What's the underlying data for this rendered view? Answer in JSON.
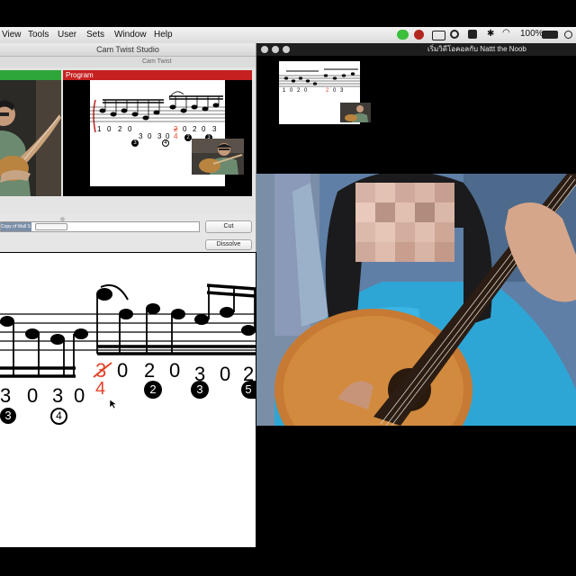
{
  "menubar": {
    "items": [
      "View",
      "Tools",
      "User",
      "Sets",
      "Window",
      "Help"
    ],
    "battery": "100%"
  },
  "cam_window": {
    "title": "Cam Twist Studio",
    "subtitle": "Cam Twist",
    "program_label": "Program",
    "source_field": "Copy of Wall S",
    "cut_button": "Cut",
    "dissolve_button": "Dissolve"
  },
  "video_window": {
    "title": "เริ่มวิดีโอคอลกับ Nattt the Noob"
  },
  "sheet_large": {
    "numbers": [
      "3",
      "0",
      "3",
      "0",
      "3",
      "0",
      "2",
      "0",
      "3",
      "0",
      "2"
    ],
    "red_fingering": "4",
    "circles": [
      "3",
      "4",
      "2",
      "3",
      "5"
    ]
  },
  "sheet_program": {
    "numbers": [
      "1",
      "0",
      "2",
      "0",
      "3",
      "0",
      "3",
      "0",
      "2",
      "0",
      "2",
      "0",
      "3"
    ],
    "red_fingering": "4",
    "circles": [
      "3",
      "4",
      "2",
      "3"
    ]
  },
  "sheet_thumb": {
    "numbers": [
      "1",
      "0",
      "2",
      "0",
      "2",
      "0",
      "3"
    ]
  },
  "colors": {
    "preview_green": "#2fa53a",
    "program_red": "#c62020",
    "fingering_red": "#e1452a"
  }
}
